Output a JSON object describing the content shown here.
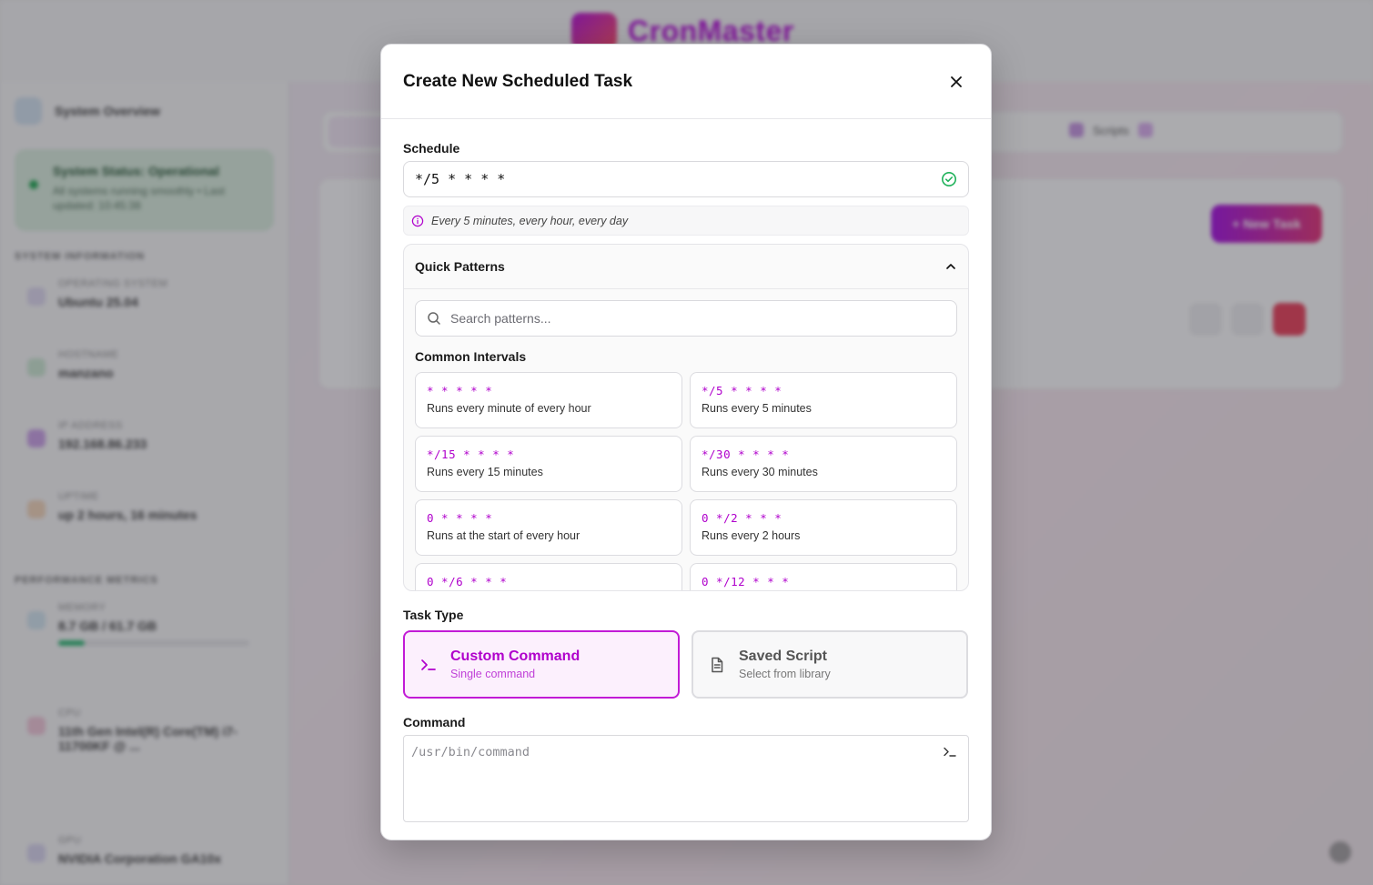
{
  "background": {
    "brand": "CronMaster",
    "sidebar": {
      "header": "System Overview",
      "status_title": "System Status: Operational",
      "status_sub": "All systems running smoothly • Last updated: 10:45:38",
      "section_system": "System Information",
      "items": [
        {
          "label": "Operating System",
          "value": "Ubuntu 25.04"
        },
        {
          "label": "Hostname",
          "value": "manzano"
        },
        {
          "label": "IP Address",
          "value": "192.168.86.233"
        },
        {
          "label": "Uptime",
          "value": "up 2 hours, 16 minutes"
        }
      ],
      "section_perf": "Performance Metrics",
      "metrics": [
        {
          "label": "Memory",
          "value": "8.7 GB / 61.7 GB",
          "progress": 0.14
        },
        {
          "label": "CPU",
          "value": "11th Gen Intel(R) Core(TM) i7-11700KF @ ..."
        },
        {
          "label": "GPU",
          "value": "NVIDIA Corporation GA10x"
        }
      ]
    },
    "main": {
      "tab_scripts": "Scripts",
      "new_task_label": "+ New Task"
    }
  },
  "modal": {
    "title": "Create New Scheduled Task",
    "schedule": {
      "label": "Schedule",
      "value": "*/5 * * * *",
      "description": "Every 5 minutes, every hour, every day"
    },
    "quick_patterns": {
      "title": "Quick Patterns",
      "search_placeholder": "Search patterns...",
      "group_title": "Common Intervals",
      "items": [
        {
          "expr": "* * * * *",
          "desc": "Runs every minute of every hour"
        },
        {
          "expr": "*/5 * * * *",
          "desc": "Runs every 5 minutes"
        },
        {
          "expr": "*/15 * * * *",
          "desc": "Runs every 15 minutes"
        },
        {
          "expr": "*/30 * * * *",
          "desc": "Runs every 30 minutes"
        },
        {
          "expr": "0 * * * *",
          "desc": "Runs at the start of every hour"
        },
        {
          "expr": "0 */2 * * *",
          "desc": "Runs every 2 hours"
        },
        {
          "expr": "0 */6 * * *",
          "desc": ""
        },
        {
          "expr": "0 */12 * * *",
          "desc": ""
        }
      ]
    },
    "task_type": {
      "label": "Task Type",
      "options": [
        {
          "title": "Custom Command",
          "sub": "Single command",
          "selected": true
        },
        {
          "title": "Saved Script",
          "sub": "Select from library",
          "selected": false
        }
      ]
    },
    "command": {
      "label": "Command",
      "placeholder": "/usr/bin/command",
      "value": ""
    }
  },
  "colors": {
    "accent": "#b000cc",
    "success": "#1fb25a"
  }
}
